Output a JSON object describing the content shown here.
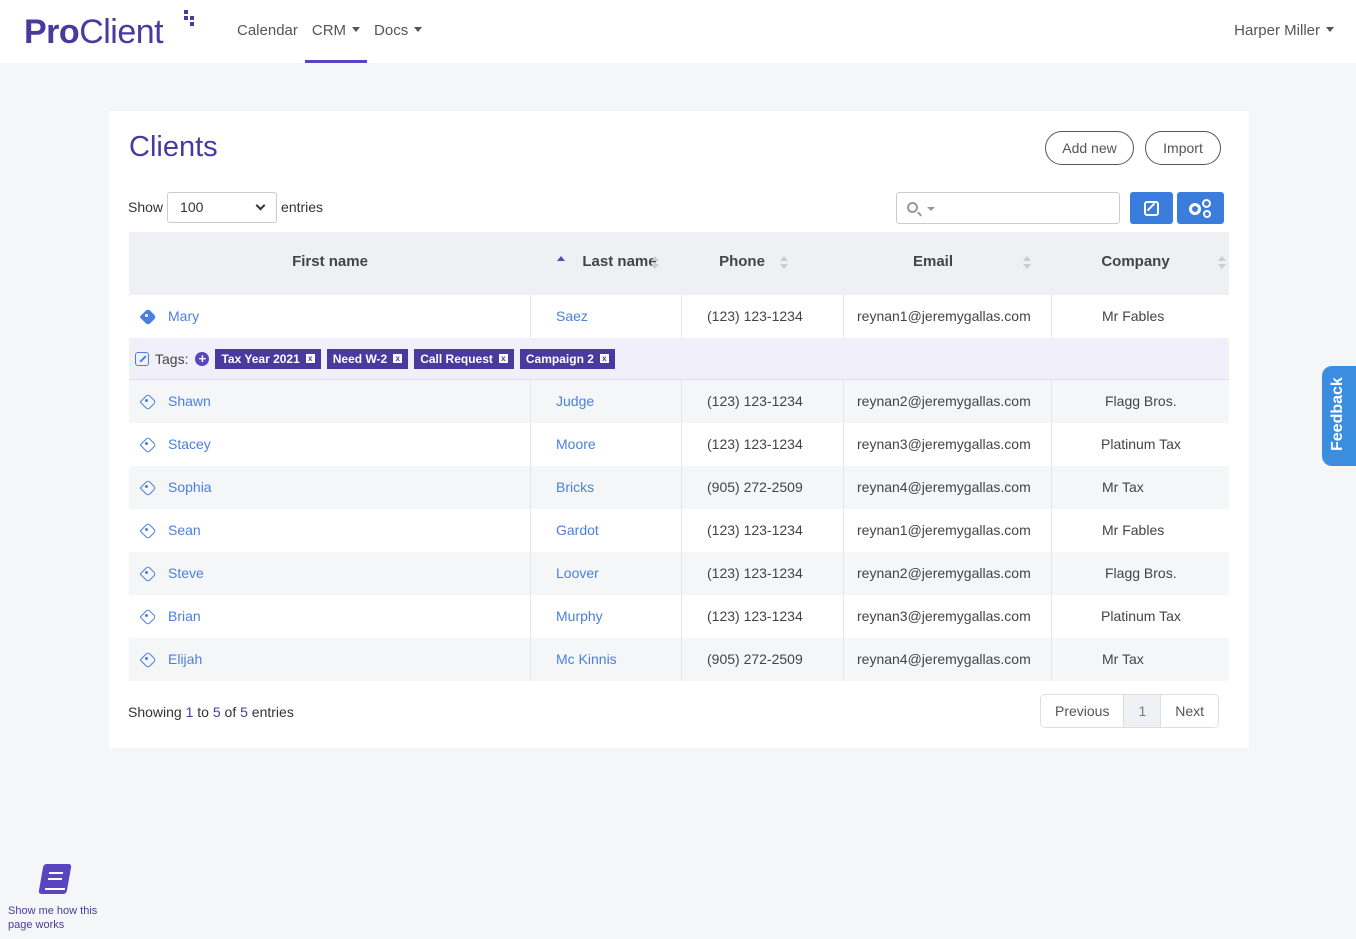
{
  "brand": {
    "name_bold": "Pro",
    "name_rest": "Client"
  },
  "nav": {
    "items": [
      {
        "label": "Calendar",
        "dropdown": false,
        "active": false
      },
      {
        "label": "CRM",
        "dropdown": true,
        "active": true
      },
      {
        "label": "Docs",
        "dropdown": true,
        "active": false
      }
    ],
    "user": "Harper Miller"
  },
  "page": {
    "title": "Clients",
    "add_new": "Add new",
    "import": "Import",
    "show_label": "Show",
    "entries_label": "entries",
    "page_size": "100"
  },
  "table": {
    "columns": [
      "First name",
      "Last name",
      "Phone",
      "Email",
      "Company"
    ],
    "sorted_column": "Last name",
    "tags_label": "Tags:",
    "tags": [
      "Tax Year 2021",
      "Need W-2",
      "Call Request",
      "Campaign 2"
    ],
    "tag_remove": "x",
    "rows": [
      {
        "first": "Mary",
        "last": "Saez",
        "phone": "(123) 123-1234",
        "email": "reynan1@jeremygallas.com",
        "company": "Mr Fables"
      },
      {
        "first": "Shawn",
        "last": "Judge",
        "phone": "(123) 123-1234",
        "email": "reynan2@jeremygallas.com",
        "company": "Flagg Bros."
      },
      {
        "first": "Stacey",
        "last": "Moore",
        "phone": "(123) 123-1234",
        "email": "reynan3@jeremygallas.com",
        "company": "Platinum Tax"
      },
      {
        "first": "Sophia",
        "last": "Bricks",
        "phone": "(905) 272-2509",
        "email": "reynan4@jeremygallas.com",
        "company": "Mr Tax"
      },
      {
        "first": "Sean",
        "last": "Gardot",
        "phone": "(123) 123-1234",
        "email": "reynan1@jeremygallas.com",
        "company": "Mr Fables"
      },
      {
        "first": "Steve",
        "last": "Loover",
        "phone": "(123) 123-1234",
        "email": "reynan2@jeremygallas.com",
        "company": "Flagg Bros."
      },
      {
        "first": "Brian",
        "last": "Murphy",
        "phone": "(123) 123-1234",
        "email": "reynan3@jeremygallas.com",
        "company": "Platinum Tax"
      },
      {
        "first": "Elijah",
        "last": "Mc Kinnis",
        "phone": "(905) 272-2509",
        "email": "reynan4@jeremygallas.com",
        "company": "Mr Tax"
      }
    ]
  },
  "footer": {
    "showing_prefix": "Showing ",
    "showing_from": "1",
    "showing_mid1": " to ",
    "showing_to": "5",
    "showing_mid2": " of ",
    "showing_total": "5",
    "showing_suffix": " entries",
    "previous": "Previous",
    "current_page": "1",
    "next": "Next"
  },
  "feedback": "Feedback",
  "help": "Show me how this page works",
  "colors": {
    "brand": "#4a3aa0",
    "accent": "#3b7ddd",
    "link": "#4a7fe0"
  }
}
